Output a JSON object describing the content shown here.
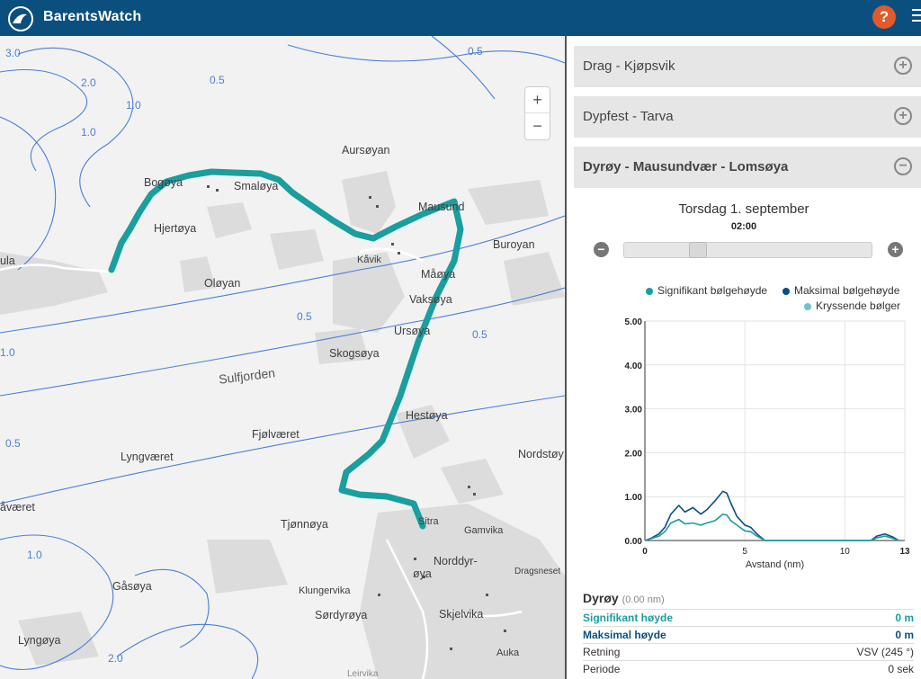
{
  "header": {
    "brand": "BarentsWatch",
    "help": "?"
  },
  "map": {
    "zoom_in": "+",
    "zoom_out": "−",
    "places": {
      "aursoyan": "Aursøyan",
      "bogoya": "Bogøya",
      "smaloya": "Smaløya",
      "hjertoya": "Hjertøya",
      "mausund": "Mausund",
      "kavik": "Kåvik",
      "buroyan": "Buroyan",
      "maroya": "Måøya",
      "olyan": "Oløyan",
      "vaksoya": "Vaksøya",
      "ursoya": "Ursøya",
      "skogsoya": "Skogsøya",
      "sulfjorden": "Sulfjorden",
      "hestoya": "Hestøya",
      "fjolvaeret": "Fjølværet",
      "lyngvaeret": "Lyngværet",
      "nordstoy": "Nordstøy",
      "avaeret": "åværet",
      "tjonnoya": "Tjønnøya",
      "sitra": "Sitra",
      "gamvika": "Gamvika",
      "norddyr": "Norddyr-",
      "oya": "øya",
      "dragsneset": "Dragsneset",
      "gasoya": "Gåsøya",
      "klungervika": "Klungervika",
      "sordyroya": "Sørdyrøya",
      "skjelvika": "Skjelvika",
      "lyngoya": "Lyngøya",
      "auka": "Auka",
      "leirvika": "Leirvika",
      "ula": "ula"
    },
    "depth_labels": [
      "0.5",
      "1.0",
      "2.0",
      "3.0",
      "0.5",
      "1.0",
      "0.5",
      "0.5",
      "1.0",
      "0.5",
      "1.0",
      "2.0"
    ],
    "route_color": "#1a9e9e"
  },
  "panel": {
    "sections": [
      {
        "label": "Drag - Kjøpsvik",
        "state": "collapsed"
      },
      {
        "label": "Dypfest - Tarva",
        "state": "collapsed"
      },
      {
        "label": "Dyrøy - Mausundvær - Lomsøya",
        "state": "expanded"
      }
    ],
    "date": "Torsdag 1. september",
    "time": "02:00",
    "slider": {
      "minus": "−",
      "plus": "+",
      "position_fraction": 0.28
    },
    "legend": {
      "sig": "Signifikant bølgehøyde",
      "max": "Maksimal bølgehøyde",
      "cross": "Kryssende bølger"
    },
    "colors": {
      "sig": "#1a9e9e",
      "max": "#0b4f7f",
      "cross": "#6ec3cf"
    },
    "stats": {
      "place": "Dyrøy",
      "distance": "(0.00 nm)",
      "sig_label": "Signifikant høyde",
      "sig_value": "0 m",
      "max_label": "Maksimal høyde",
      "max_value": "0 m",
      "dir_label": "Retning",
      "dir_value": "VSV (245 °)",
      "period_label": "Periode",
      "period_value": "0 sek"
    }
  },
  "chart_data": {
    "type": "line",
    "xlabel": "Avstand (nm)",
    "ylabel": "",
    "xlim": [
      0,
      13
    ],
    "ylim": [
      0,
      5
    ],
    "x_ticks": [
      "0",
      "5",
      "10",
      "13"
    ],
    "y_ticks": [
      "0.00",
      "1.00",
      "2.00",
      "3.00",
      "4.00",
      "5.00"
    ],
    "grid": true,
    "legend_position": "top-right",
    "series": [
      {
        "name": "Maksimal bølgehøyde",
        "x": [
          0,
          0.3,
          0.7,
          1.0,
          1.3,
          1.7,
          2.0,
          2.4,
          2.8,
          3.1,
          3.5,
          3.9,
          4.1,
          4.3,
          4.6,
          5.0,
          5.3,
          5.6,
          6.0,
          11.3,
          11.6,
          12.0,
          12.4,
          12.7
        ],
        "y": [
          0,
          0.05,
          0.15,
          0.3,
          0.6,
          0.8,
          0.65,
          0.75,
          0.6,
          0.7,
          0.9,
          1.12,
          1.08,
          0.85,
          0.55,
          0.35,
          0.3,
          0.15,
          0,
          0,
          0.1,
          0.15,
          0.08,
          0
        ]
      },
      {
        "name": "Signifikant bølgehøyde",
        "x": [
          0,
          0.3,
          0.7,
          1.0,
          1.3,
          1.7,
          2.0,
          2.4,
          2.8,
          3.1,
          3.5,
          3.9,
          4.1,
          4.3,
          4.6,
          5.0,
          5.3,
          5.6,
          6.0,
          11.3,
          11.6,
          12.0,
          12.4,
          12.7
        ],
        "y": [
          0,
          0.04,
          0.1,
          0.2,
          0.4,
          0.48,
          0.38,
          0.4,
          0.35,
          0.4,
          0.45,
          0.6,
          0.58,
          0.45,
          0.35,
          0.22,
          0.2,
          0.1,
          0,
          0,
          0.06,
          0.1,
          0.05,
          0
        ]
      }
    ]
  }
}
